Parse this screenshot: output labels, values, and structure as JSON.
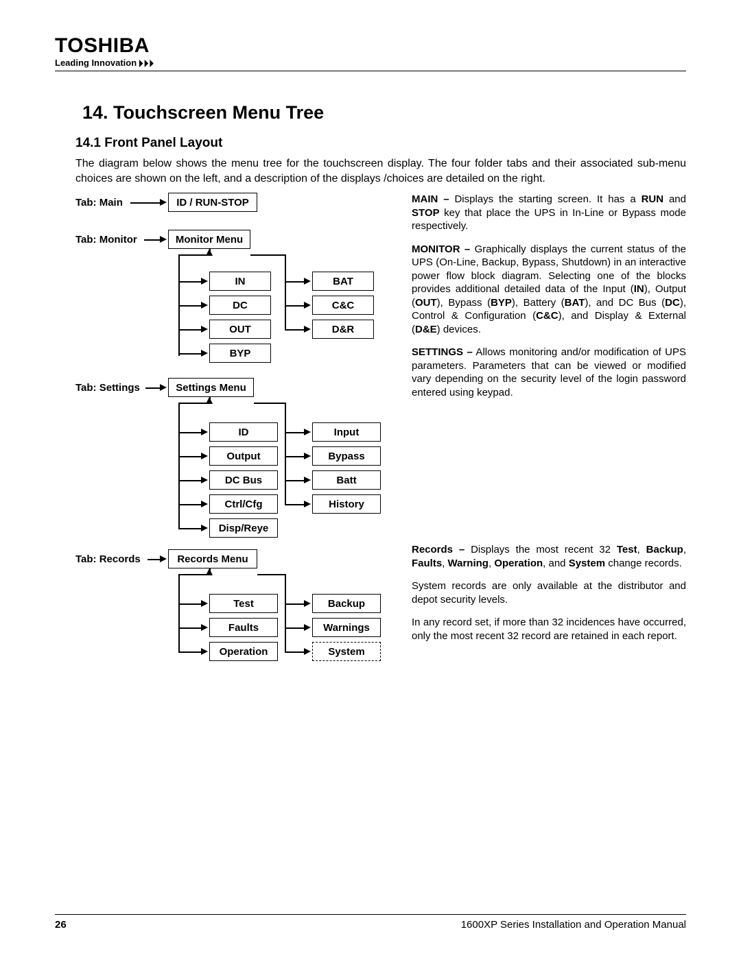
{
  "brand": "TOSHIBA",
  "tagline": "Leading Innovation",
  "section_title": "14.  Touchscreen Menu Tree",
  "subsection_title": "14.1  Front Panel Layout",
  "intro": "The diagram below shows the menu tree for the touchscreen display.  The four folder tabs and their associated sub-menu choices are shown on the left, and a description of the displays /choices are detailed on the  right.",
  "tabs": {
    "main": {
      "label": "Tab: Main",
      "target": "ID / RUN-STOP"
    },
    "monitor": {
      "label": "Tab: Monitor",
      "target": "Monitor Menu",
      "col1": [
        "IN",
        "DC",
        "OUT",
        "BYP"
      ],
      "col2": [
        "BAT",
        "C&C",
        "D&R"
      ]
    },
    "settings": {
      "label": "Tab: Settings",
      "target": "Settings Menu",
      "col1": [
        "ID",
        "Output",
        "DC Bus",
        "Ctrl/Cfg",
        "Disp/Reye"
      ],
      "col2": [
        "Input",
        "Bypass",
        "Batt",
        "History"
      ]
    },
    "records": {
      "label": "Tab: Records",
      "target": "Records Menu",
      "col1": [
        "Test",
        "Faults",
        "Operation"
      ],
      "col2": [
        "Backup",
        "Warnings",
        "System"
      ]
    }
  },
  "descriptions": {
    "main_lead": "MAIN –",
    "main_body": " Displays the starting screen.  It has a ",
    "main_run": "RUN",
    "main_and": " and ",
    "main_stop": "STOP",
    "main_tail": " key that place the UPS in In-Line or Bypass mode respectively.",
    "monitor_lead": "MONITOR –",
    "monitor_body1": " Graphically displays the current status of the UPS (On-Line, Backup, Bypass, Shutdown) in an interactive power flow block diagram. Selecting one of the blocks provides additional detailed data of the Input (",
    "monitor_IN": "IN",
    "monitor_b2": "), Output (",
    "monitor_OUT": "OUT",
    "monitor_b3": "), Bypass (",
    "monitor_BYP": "BYP",
    "monitor_b4": "), Battery (",
    "monitor_BAT": "BAT",
    "monitor_b5": "), and DC Bus (",
    "monitor_DC": "DC",
    "monitor_b6": "), Control & Configura­tion (",
    "monitor_CC": "C&C",
    "monitor_b7": "), and Display & External (",
    "monitor_DE": "D&E",
    "monitor_b8": ") devices.",
    "settings_lead": "SETTINGS –",
    "settings_body": " Allows monitoring and/or modification of UPS pa­rameters.  Parameters that can be viewed or modified vary depending on the security level of the login password entered using keypad.",
    "records_lead": "Records –",
    "records_body1": " Displays the most re­cent 32 ",
    "records_test": "Test",
    "records_c1": ", ",
    "records_backup": "Backup",
    "records_c2": ", ",
    "records_faults": "Faults",
    "records_c3": ", ",
    "records_warning": "Warning",
    "records_c4": ", ",
    "records_operation": "Operation",
    "records_c5": ", and ",
    "records_system": "System",
    "records_tail": " change records.",
    "records_p2": "System records are only available at the distributor and depot security levels.",
    "records_p3": "In any record set, if more than 32 incidences have occurred, only the most recent 32 record are retained in each report."
  },
  "footer": {
    "page": "26",
    "manual": "1600XP Series Installation and Operation Manual"
  }
}
